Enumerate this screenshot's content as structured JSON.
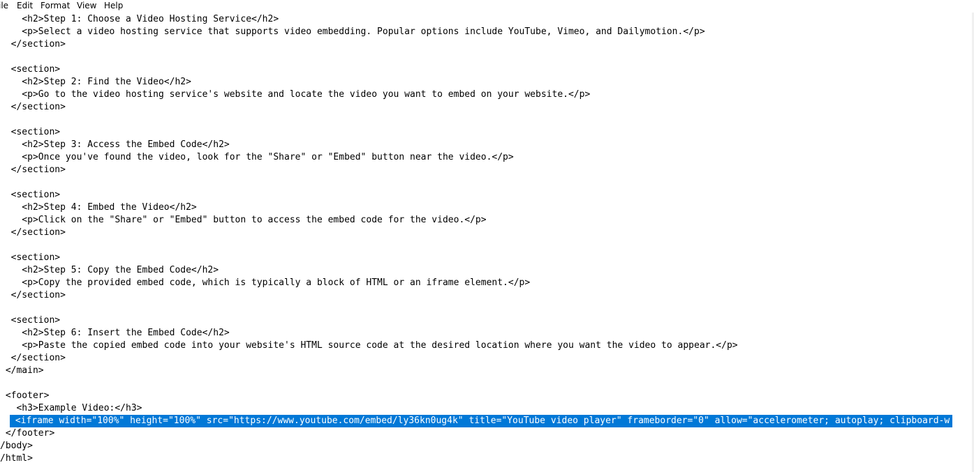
{
  "menu": [
    "ile",
    "Edit",
    "Format",
    "View",
    "Help"
  ],
  "lines": [
    "    <h2>Step 1: Choose a Video Hosting Service</h2>",
    "    <p>Select a video hosting service that supports video embedding. Popular options include YouTube, Vimeo, and Dailymotion.</p>",
    "  </section>",
    "",
    "  <section>",
    "    <h2>Step 2: Find the Video</h2>",
    "    <p>Go to the video hosting service's website and locate the video you want to embed on your website.</p>",
    "  </section>",
    "",
    "  <section>",
    "    <h2>Step 3: Access the Embed Code</h2>",
    "    <p>Once you've found the video, look for the \"Share\" or \"Embed\" button near the video.</p>",
    "  </section>",
    "",
    "  <section>",
    "    <h2>Step 4: Embed the Video</h2>",
    "    <p>Click on the \"Share\" or \"Embed\" button to access the embed code for the video.</p>",
    "  </section>",
    "",
    "  <section>",
    "    <h2>Step 5: Copy the Embed Code</h2>",
    "    <p>Copy the provided embed code, which is typically a block of HTML or an iframe element.</p>",
    "  </section>",
    "",
    "  <section>",
    "    <h2>Step 6: Insert the Embed Code</h2>",
    "    <p>Paste the copied embed code into your website's HTML source code at the desired location where you want the video to appear.</p>",
    "  </section>",
    " </main>",
    "",
    " <footer>",
    "   <h3>Example Video:</h3>",
    "  <iframe width=\"100%\" height=\"100%\" src=\"https://www.youtube.com/embed/ly36kn0ug4k\" title=\"YouTube video player\" frameborder=\"0\" allow=\"accelerometer; autoplay; clipboard-w",
    " </footer>",
    "/body>",
    "/html>"
  ],
  "selected_line": 32
}
